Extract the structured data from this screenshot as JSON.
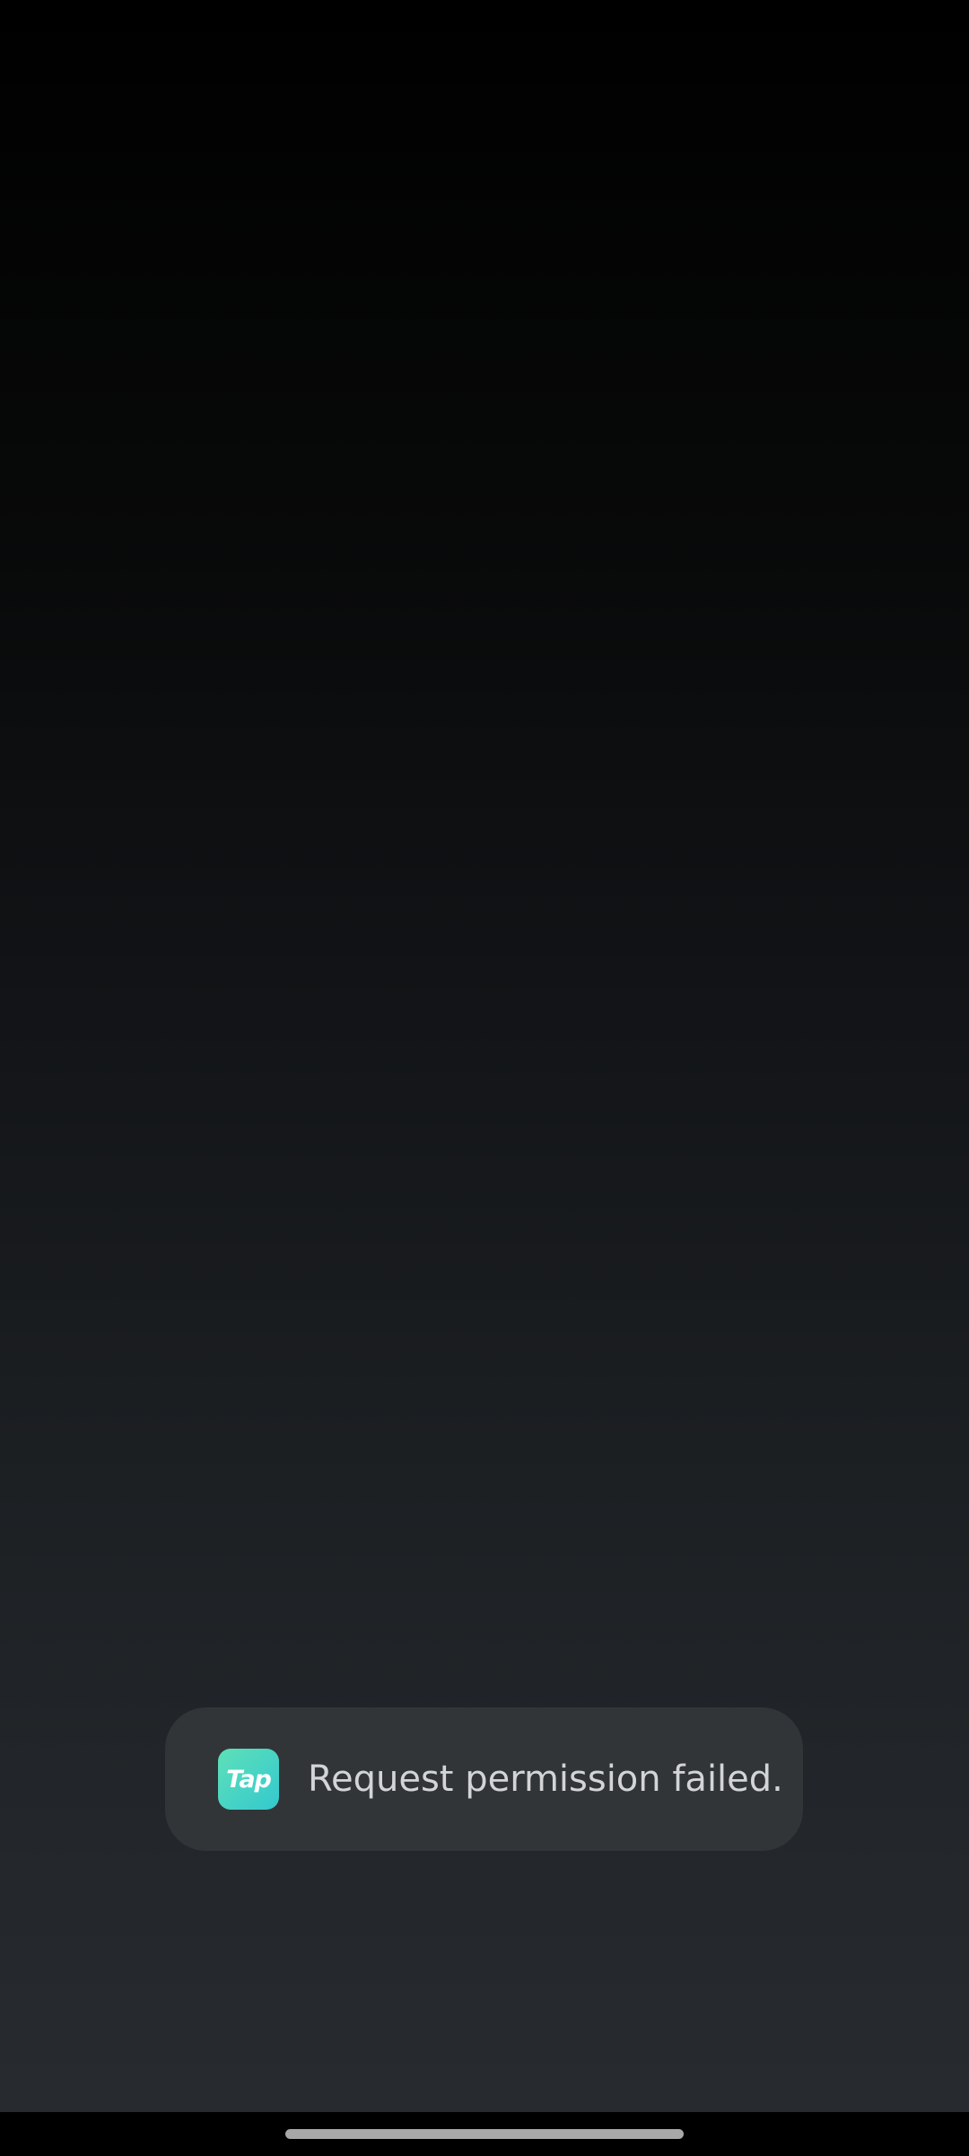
{
  "toast": {
    "app_icon": {
      "name": "taptap-app-icon",
      "text": "Tap",
      "color_start": "#5ee0b8",
      "color_end": "#34c9cf"
    },
    "message": "Request permission failed."
  },
  "colors": {
    "toast_background": "#323538",
    "toast_text": "#d2d4d6",
    "home_indicator": "#a8a8a8"
  }
}
